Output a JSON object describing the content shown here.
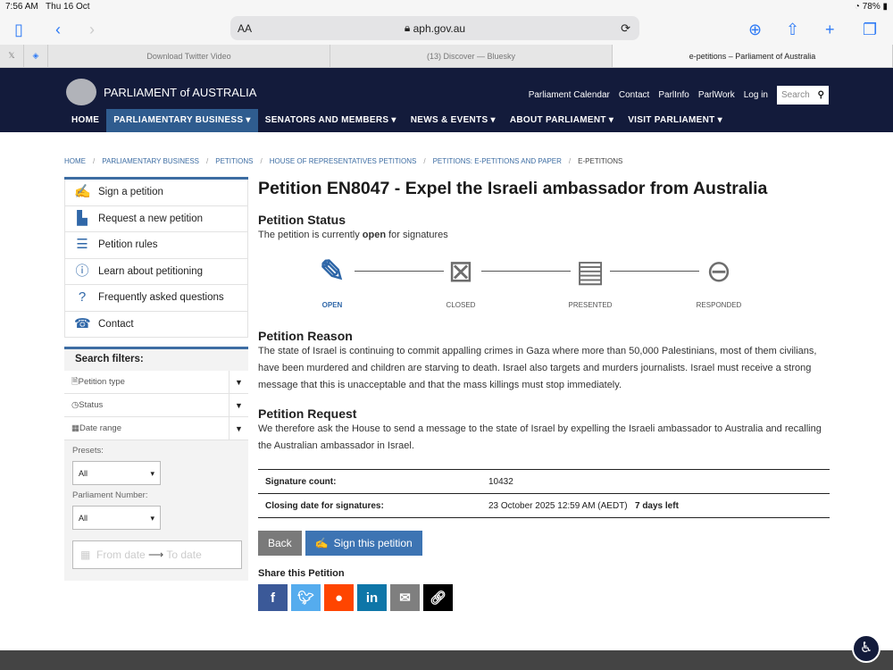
{
  "statusbar": {
    "time": "7:56 AM",
    "date": "Thu 16 Oct",
    "battery": "78%"
  },
  "browser": {
    "url": "aph.gov.au",
    "aa": "AA",
    "tabs": [
      {
        "label": "Download Twitter Video"
      },
      {
        "label": "(13) Discover — Bluesky"
      },
      {
        "label": "e-petitions – Parliament of Australia"
      }
    ]
  },
  "header": {
    "logo": "PARLIAMENT of AUSTRALIA",
    "util": [
      "Parliament Calendar",
      "Contact",
      "ParlInfo",
      "ParlWork",
      "Log in"
    ],
    "search_placeholder": "Search",
    "nav": [
      "HOME",
      "PARLIAMENTARY BUSINESS ▾",
      "SENATORS AND MEMBERS ▾",
      "NEWS & EVENTS ▾",
      "ABOUT PARLIAMENT ▾",
      "VISIT PARLIAMENT ▾"
    ]
  },
  "breadcrumb": [
    "HOME",
    "PARLIAMENTARY BUSINESS",
    "PETITIONS",
    "HOUSE OF REPRESENTATIVES PETITIONS",
    "PETITIONS: E-PETITIONS AND PAPER",
    "E-PETITIONS"
  ],
  "sidebar": {
    "items": [
      "Sign a petition",
      "Request a new petition",
      "Petition rules",
      "Learn about petitioning",
      "Frequently asked questions",
      "Contact"
    ]
  },
  "filters": {
    "title": "Search filters:",
    "rows": [
      "Petition type",
      "Status",
      "Date range"
    ],
    "presets_label": "Presets:",
    "presets_value": "All",
    "parl_label": "Parliament Number:",
    "parl_value": "All",
    "from": "From date",
    "to": "To date"
  },
  "petition": {
    "title": "Petition EN8047 - Expel the Israeli ambassador from Australia",
    "status_heading": "Petition Status",
    "status_pre": "The petition is currently ",
    "status_word": "open",
    "status_post": " for signatures",
    "steps": [
      "OPEN",
      "CLOSED",
      "PRESENTED",
      "RESPONDED"
    ],
    "reason_heading": "Petition Reason",
    "reason": "The state of Israel is continuing to commit appalling crimes in Gaza where more than 50,000 Palestinians, most of them civilians, have been murdered and children are starving to death. Israel also targets and murders journalists. Israel must receive a strong message that this is unacceptable and that the mass killings must stop immediately.",
    "request_heading": "Petition Request",
    "request": "We therefore ask the House to send a message to the state of Israel by expelling the Israeli ambassador to Australia and recalling the Australian ambassador in Israel.",
    "sig_label": "Signature count:",
    "sig_value": "10432",
    "close_label": "Closing date for signatures:",
    "close_value": "23 October 2025 12:59 AM (AEDT)",
    "days_left": "7 days left",
    "back": "Back",
    "sign": "Sign this petition",
    "share_heading": "Share this Petition"
  }
}
